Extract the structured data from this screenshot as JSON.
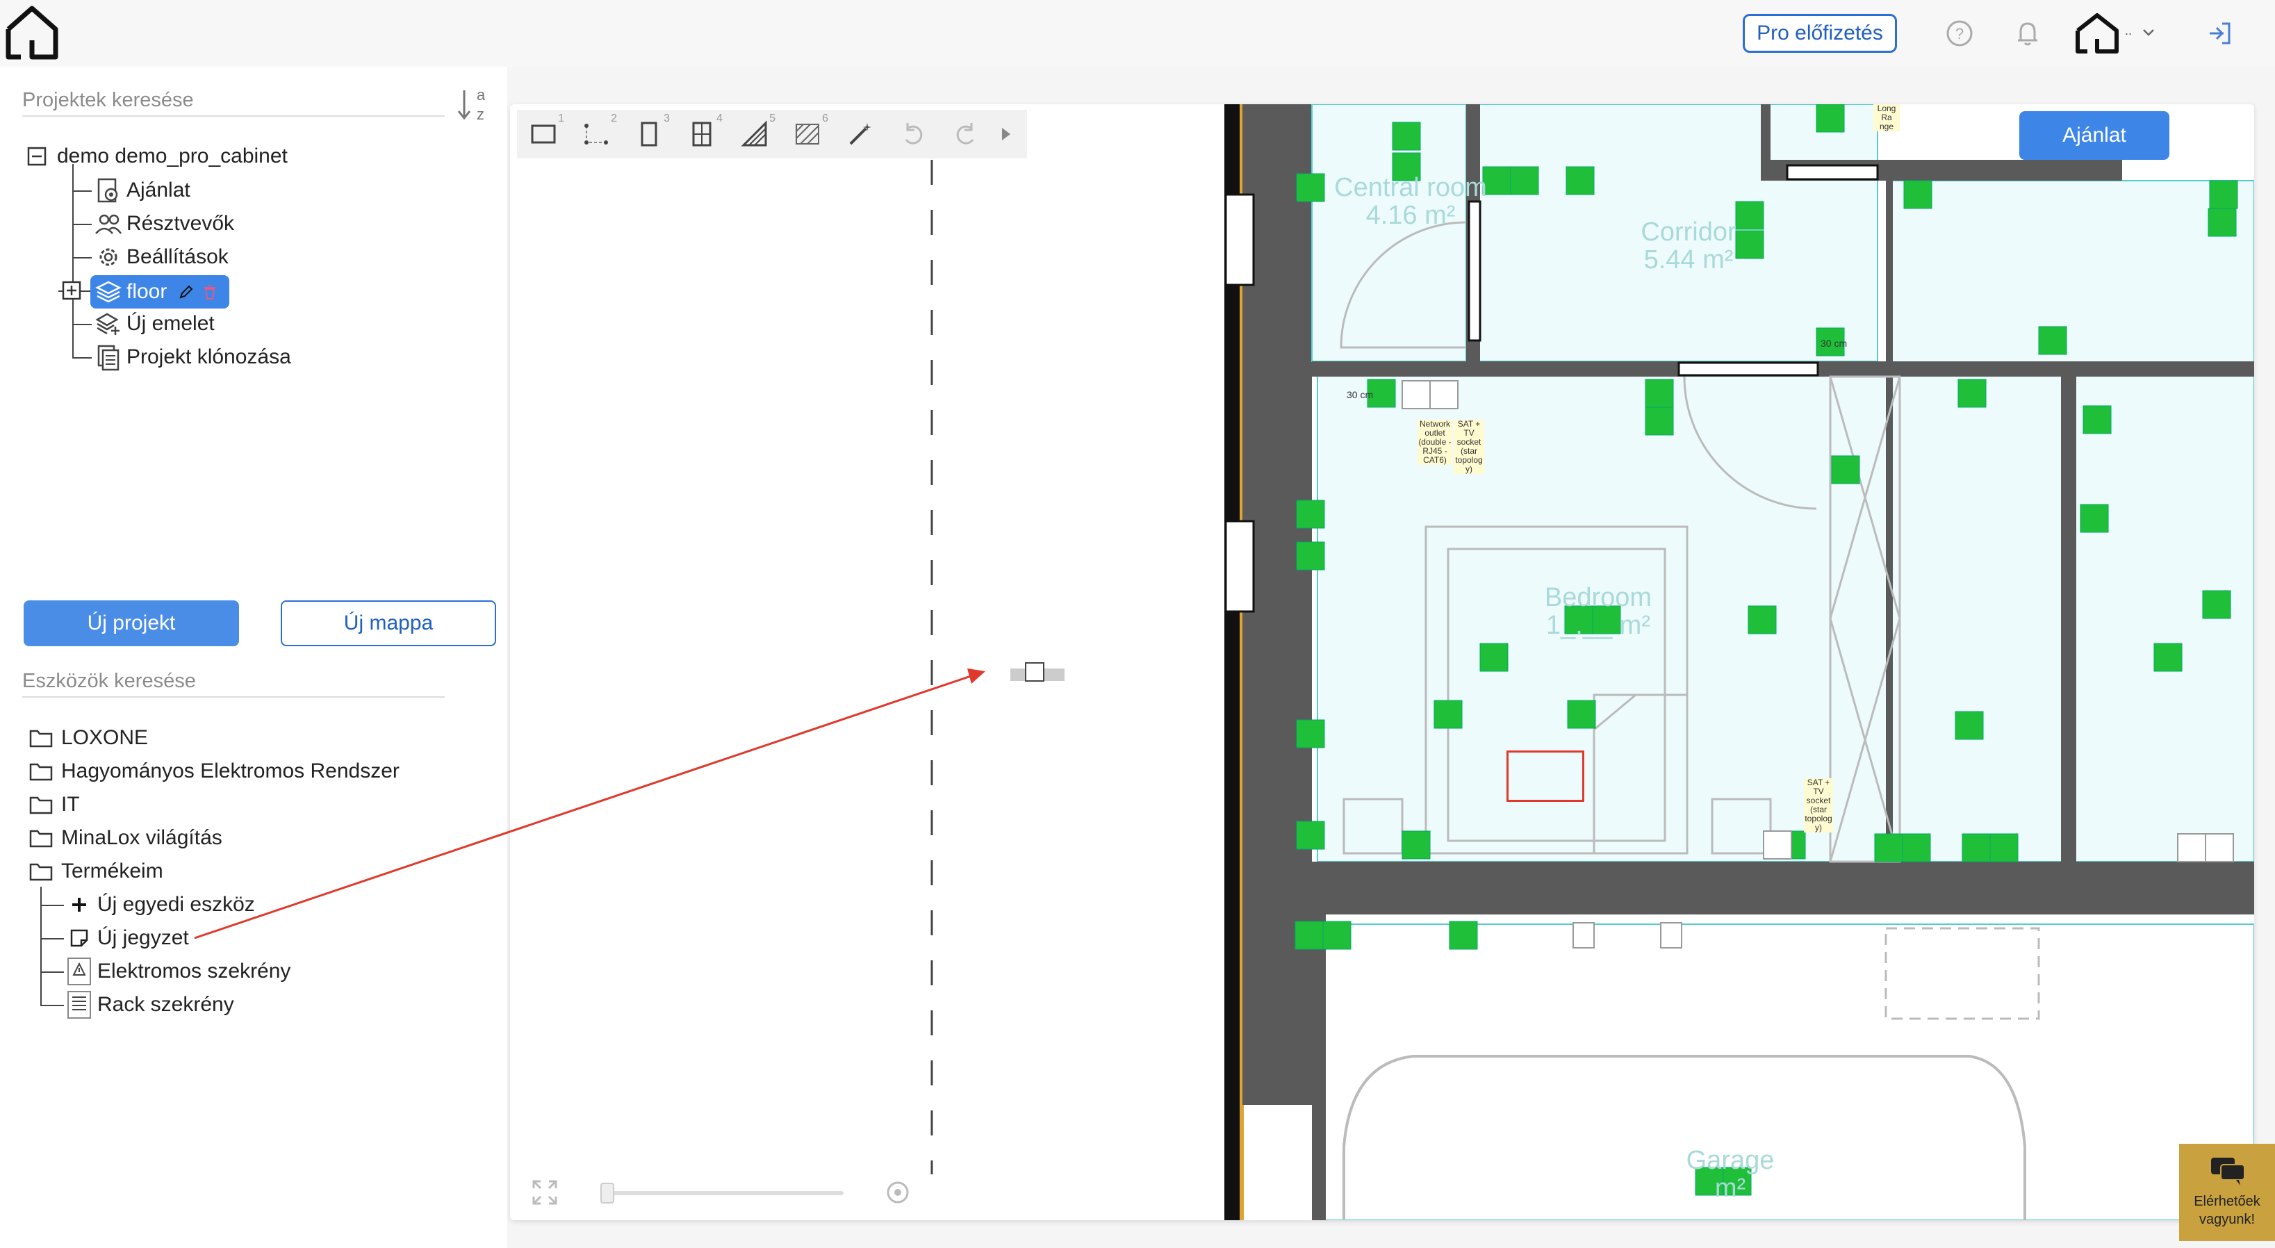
{
  "header": {
    "pro_label": "Pro előfizetés",
    "user_suffix": "..",
    "icons": [
      "home-logo-icon",
      "help-icon",
      "bell-icon",
      "user-home-icon",
      "chevron-down-icon",
      "logout-icon"
    ]
  },
  "projects": {
    "search_placeholder": "Projektek keresése",
    "sort_label_a": "a",
    "sort_label_z": "z",
    "root_label": "demo demo_pro_cabinet",
    "items": [
      {
        "label": "Ajánlat",
        "icon": "gear-doc-icon"
      },
      {
        "label": "Résztvevők",
        "icon": "users-icon"
      },
      {
        "label": "Beállítások",
        "icon": "gear-icon"
      },
      {
        "label": "floor",
        "icon": "layers-icon"
      },
      {
        "label": "Új emelet",
        "icon": "add-layer-icon"
      },
      {
        "label": "Projekt klónozása",
        "icon": "clone-icon"
      }
    ],
    "new_project": "Új projekt",
    "new_folder": "Új mappa"
  },
  "devices": {
    "search_placeholder": "Eszközök keresése",
    "folders": [
      "LOXONE",
      "Hagyományos Elektromos Rendszer",
      "IT",
      "MinaLox világítás",
      "Termékeim"
    ],
    "my_items": [
      {
        "label": "Új egyedi eszköz",
        "icon": "plus-icon"
      },
      {
        "label": "Új jegyzet",
        "icon": "note-icon"
      },
      {
        "label": "Elektromos szekrény",
        "icon": "electrical-cabinet-icon"
      },
      {
        "label": "Rack szekrény",
        "icon": "rack-cabinet-icon"
      }
    ]
  },
  "toolbar": {
    "numbers": [
      "1",
      "2",
      "3",
      "4",
      "5",
      "6"
    ]
  },
  "canvas": {
    "ajanlat_label": "Ajánlat",
    "rooms": [
      {
        "name": "Central room",
        "area": "4.16 m²"
      },
      {
        "name": "Corridor",
        "area": "5.44 m²"
      },
      {
        "name": "Bedroom",
        "area": "1_.__ m²"
      },
      {
        "name": "Garage",
        "area": "m²"
      }
    ],
    "small_labels": {
      "cm30": "30 cm",
      "network": "Network outlet (double - RJ45 - CAT6)",
      "sat": "SAT + TV socket (star topolog y)",
      "long_range": "Long Ra nge"
    }
  },
  "chat": {
    "label_line1": "Elérhetőek",
    "label_line2": "vagyunk!"
  },
  "colors": {
    "accent": "#3d86e8",
    "device_green": "#1fbf3a",
    "wall": "#5a5a5a",
    "room_fill": "#eefbfc",
    "annotation_red": "#e0392b",
    "chat_bg": "#c9a23f"
  }
}
